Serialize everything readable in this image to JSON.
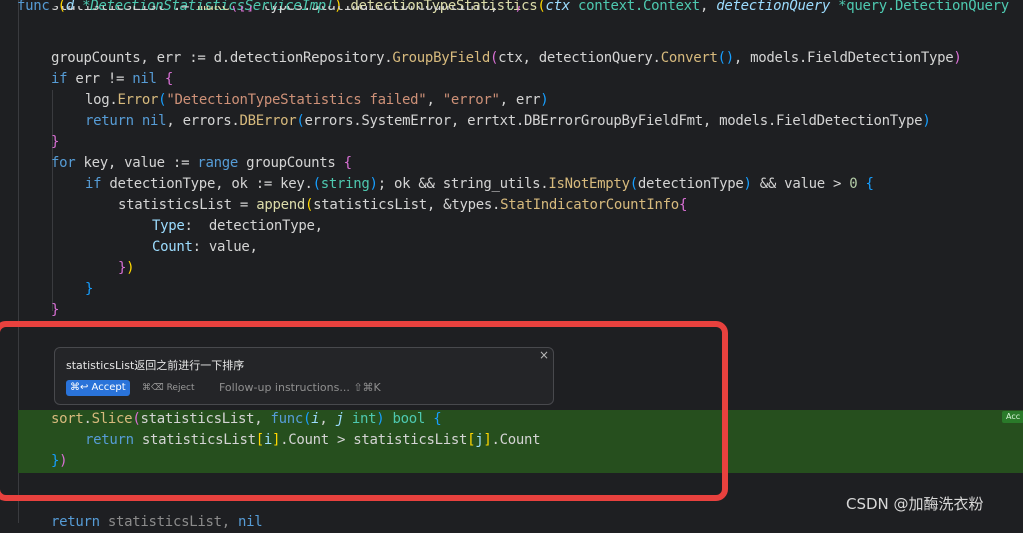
{
  "prompt": {
    "text": "statisticsList返回之前进行一下排序",
    "accept_label": "⌘↩ Accept",
    "reject_label": "⌘⌫ Reject",
    "followup_placeholder": "Follow-up instructions... ⇧⌘K",
    "close_glyph": "×"
  },
  "side_accept_label": "Acc",
  "watermark": "CSDN @加酶洗衣粉",
  "colors": {
    "accent": "#2a73d9",
    "accepted_bg": "#264f1e",
    "highlight_border": "#e8413e"
  }
}
